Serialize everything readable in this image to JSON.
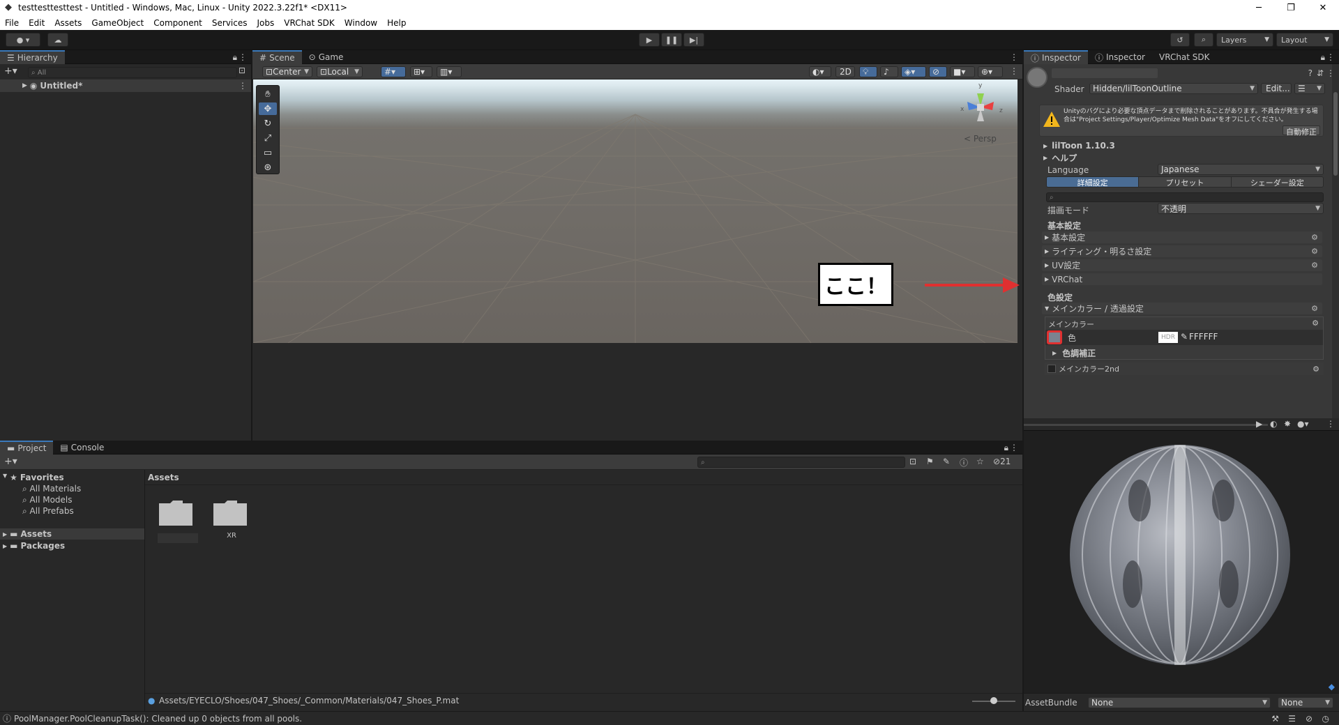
{
  "window": {
    "title": "testtesttesttest - Untitled - Windows, Mac, Linux - Unity 2022.3.22f1* <DX11>",
    "min": "─",
    "max": "❐",
    "close": "✕"
  },
  "menu": [
    "File",
    "Edit",
    "Assets",
    "GameObject",
    "Component",
    "Services",
    "Jobs",
    "VRChat SDK",
    "Window",
    "Help"
  ],
  "toolbar": {
    "layers": "Layers",
    "layout": "Layout"
  },
  "hierarchy": {
    "tab": "Hierarchy",
    "search_placeholder": "All",
    "scene_item": "Untitled*"
  },
  "scene_view": {
    "tabs": [
      "Scene",
      "Game"
    ],
    "pivot": "Center",
    "space": "Local",
    "mode_2d": "2D",
    "persp": "< Persp",
    "gizmo_x": "x",
    "gizmo_y": "y",
    "gizmo_z": "z"
  },
  "annotation": {
    "callout": "ここ！",
    "arrow_color": "#e03030"
  },
  "inspector": {
    "tabs": [
      "Inspector",
      "Inspector",
      "VRChat SDK"
    ],
    "shader_label": "Shader",
    "shader_value": "Hidden/lilToonOutline",
    "edit_button": "Edit...",
    "warning": "Unityのバグにより必要な頂点データまで削除されることがあります。不具合が発生する場合は\"Project Settings/Player/Optimize Mesh Data\"をオフにしてください。",
    "auto_fix": "自動修正",
    "version": "lilToon 1.10.3",
    "help": "ヘルプ",
    "language_label": "Language",
    "language_value": "Japanese",
    "mode_tabs": [
      "詳細設定",
      "プリセット",
      "シェーダー設定"
    ],
    "render_mode_label": "描画モード",
    "render_mode_value": "不透明",
    "basic_header": "基本設定",
    "basic_items": [
      "基本設定",
      "ライティング・明るさ設定",
      "UV設定",
      "VRChat"
    ],
    "color_header": "色設定",
    "main_color_fold": "メインカラー / 透過設定",
    "main_color_label": "メインカラー",
    "color_field_label": "色",
    "hdr": "HDR",
    "hex": "FFFFFF",
    "tone_correction": "色調補正",
    "main_color_2nd": "メインカラー2nd"
  },
  "preview": {
    "assetbundle_label": "AssetBundle",
    "assetbundle_value": "None",
    "variant_value": "None"
  },
  "project": {
    "tabs": [
      "Project",
      "Console"
    ],
    "favorites": "Favorites",
    "fav_items": [
      "All Materials",
      "All Models",
      "All Prefabs"
    ],
    "tree": [
      "Assets",
      "Packages"
    ],
    "breadcrumb": "Assets",
    "folders": [
      "",
      "XR"
    ],
    "count": "21",
    "footer_path": "Assets/EYECLO/Shoes/047_Shoes/_Common/Materials/047_Shoes_P.mat"
  },
  "status": {
    "message": "PoolManager.PoolCleanupTask(): Cleaned up 0 objects from all pools."
  },
  "colors": {
    "accent": "#3a79bb",
    "selected_tab": "#4a6c94",
    "highlight": "#e03030"
  }
}
